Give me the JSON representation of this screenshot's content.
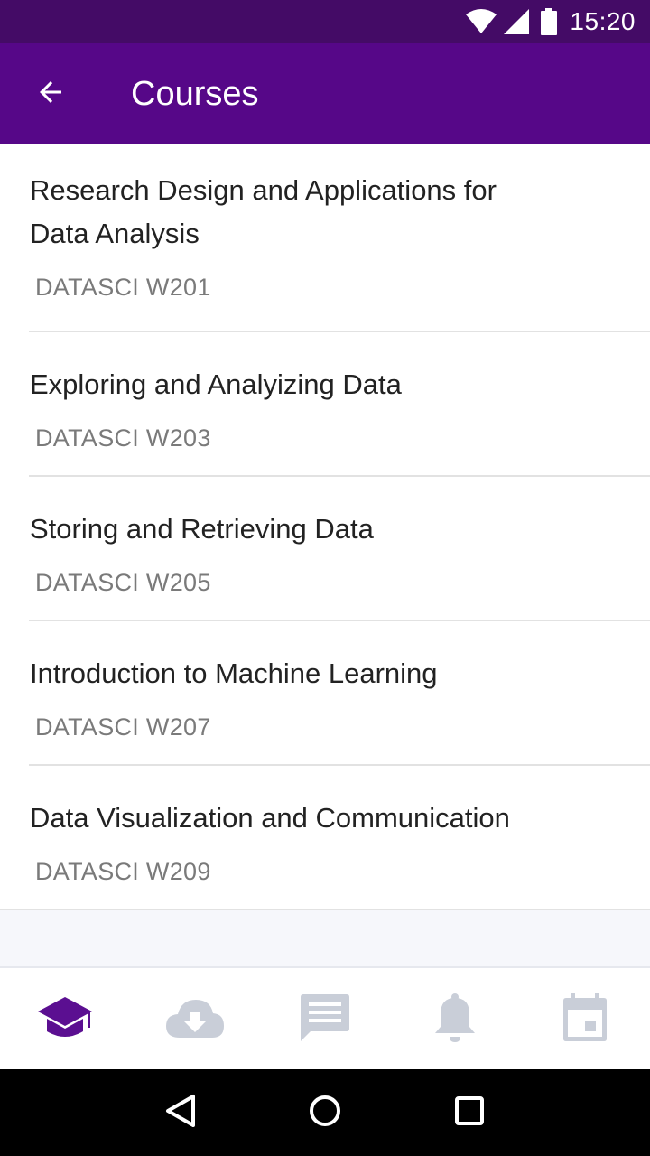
{
  "status_bar": {
    "time": "15:20",
    "icons": [
      "wifi-icon",
      "cellular-signal-icon",
      "battery-icon"
    ]
  },
  "app_bar": {
    "title": "Courses",
    "back_icon": "arrow-back-icon"
  },
  "courses": [
    {
      "title": "Research Design and Applications for Data Analysis",
      "code": "DATASCI W201"
    },
    {
      "title": "Exploring and Analyizing Data",
      "code": "DATASCI W203"
    },
    {
      "title": "Storing and Retrieving Data",
      "code": "DATASCI W205"
    },
    {
      "title": "Introduction to Machine Learning",
      "code": "DATASCI W207"
    },
    {
      "title": "Data Visualization and Communication",
      "code": "DATASCI W209"
    }
  ],
  "bottom_nav": {
    "items": [
      {
        "icon": "graduation-cap-icon",
        "active": true
      },
      {
        "icon": "cloud-download-icon",
        "active": false
      },
      {
        "icon": "chat-message-icon",
        "active": false
      },
      {
        "icon": "notification-bell-icon",
        "active": false
      },
      {
        "icon": "calendar-event-icon",
        "active": false
      }
    ]
  },
  "colors": {
    "status_bar": "#440b66",
    "app_bar": "#560788",
    "accent": "#5b0f91",
    "inactive_icon": "#c9ced8"
  },
  "system_nav": {
    "icons": [
      "back-triangle-icon",
      "home-circle-icon",
      "recents-square-icon"
    ]
  }
}
